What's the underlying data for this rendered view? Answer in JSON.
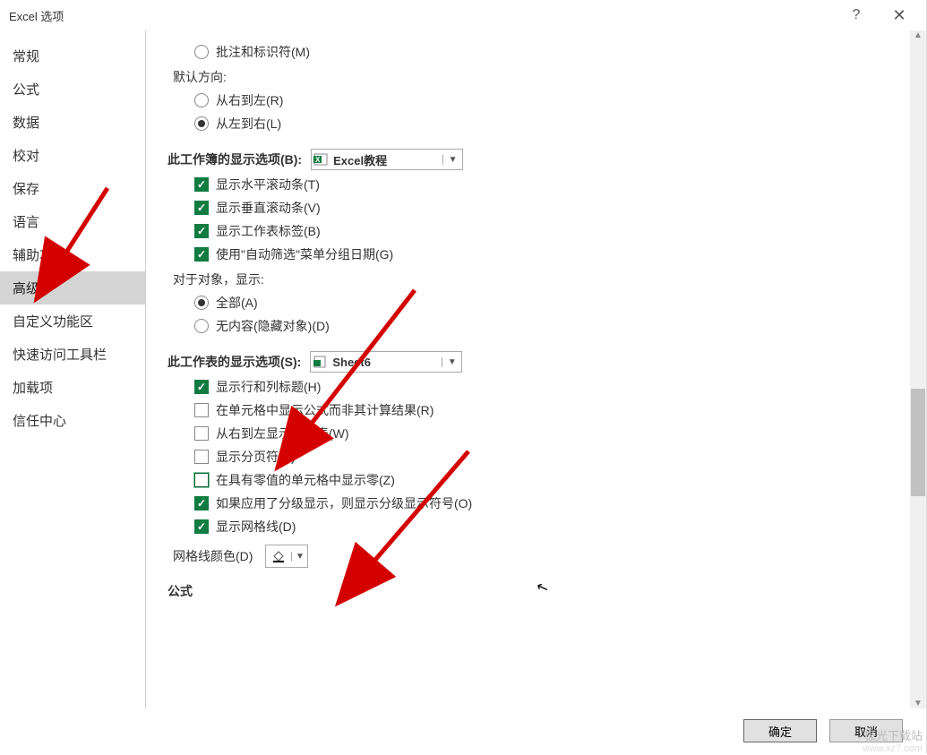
{
  "title": "Excel 选项",
  "sidebar": {
    "items": [
      {
        "label": "常规"
      },
      {
        "label": "公式"
      },
      {
        "label": "数据"
      },
      {
        "label": "校对"
      },
      {
        "label": "保存"
      },
      {
        "label": "语言"
      },
      {
        "label": "辅助功能"
      },
      {
        "label": "高级",
        "selected": true
      },
      {
        "label": "自定义功能区"
      },
      {
        "label": "快速访问工具栏"
      },
      {
        "label": "加载项"
      },
      {
        "label": "信任中心"
      }
    ]
  },
  "content": {
    "comments_indicators": "批注和标识符(M)",
    "default_direction_label": "默认方向:",
    "dir_rtl": "从右到左(R)",
    "dir_ltr": "从左到右(L)",
    "workbook_section": "此工作簿的显示选项(B):",
    "workbook_combo": "Excel教程",
    "show_hscroll": "显示水平滚动条(T)",
    "show_vscroll": "显示垂直滚动条(V)",
    "show_sheet_tabs": "显示工作表标签(B)",
    "autofilter_group": "使用\"自动筛选\"菜单分组日期(G)",
    "objects_show_label": "对于对象，显示:",
    "objects_all": "全部(A)",
    "objects_none": "无内容(隐藏对象)(D)",
    "worksheet_section": "此工作表的显示选项(S):",
    "worksheet_combo": "Sheet6",
    "show_row_col_headers": "显示行和列标题(H)",
    "show_formulas": "在单元格中显示公式而非其计算结果(R)",
    "rtl_sheet": "从右到左显示工作表(W)",
    "show_page_breaks": "显示分页符(K)",
    "show_zero": "在具有零值的单元格中显示零(Z)",
    "show_outline": "如果应用了分级显示，则显示分级显示符号(O)",
    "show_gridlines": "显示网格线(D)",
    "gridline_color_label": "网格线颜色(D)",
    "formula_section": "公式"
  },
  "footer": {
    "ok": "确定",
    "cancel": "取消"
  },
  "watermark": {
    "line1": "极光下载站",
    "line2": "www.xz7.com"
  }
}
